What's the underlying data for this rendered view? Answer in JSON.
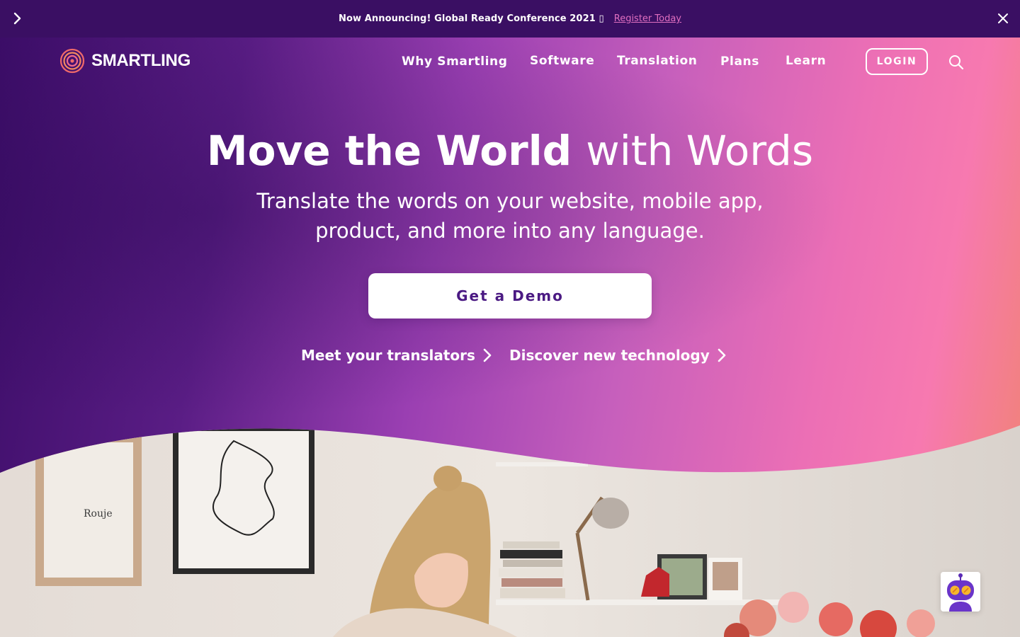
{
  "announcement": {
    "message": "Now Announcing! Global Ready Conference 2021 ▯",
    "link_label": "Register Today"
  },
  "nav": {
    "brand": "SMARTLING",
    "items": [
      {
        "label": "Why Smartling"
      },
      {
        "label": "Software"
      },
      {
        "label": "Translation"
      },
      {
        "label": "Plans"
      },
      {
        "label": "Learn"
      }
    ],
    "login_label": "LOGIN"
  },
  "hero": {
    "headline_bold": "Move the World",
    "headline_light": "with Words",
    "subheadline": "Translate the words on your website, mobile app, product, and more into any language.",
    "cta_label": "Get a Demo",
    "links": [
      {
        "label": "Meet your translators"
      },
      {
        "label": "Discover new technology"
      }
    ]
  },
  "photo": {
    "poster_text": "Rouje"
  },
  "colors": {
    "announcement_bg": "#3a0f63",
    "register_link": "#e06fc0",
    "cta_text": "#4b1a83",
    "gradient_start": "#3c0d68",
    "gradient_mid": "#c65fbc",
    "gradient_pink": "#f779b0",
    "gradient_end": "#f0846e"
  },
  "icons": {
    "announcement_left": "chevron-right-icon",
    "announcement_close": "close-icon",
    "logo": "fingerprint-logo-icon",
    "search": "search-icon",
    "link_arrow": "chevron-right-icon",
    "chat": "robot-chat-icon"
  }
}
